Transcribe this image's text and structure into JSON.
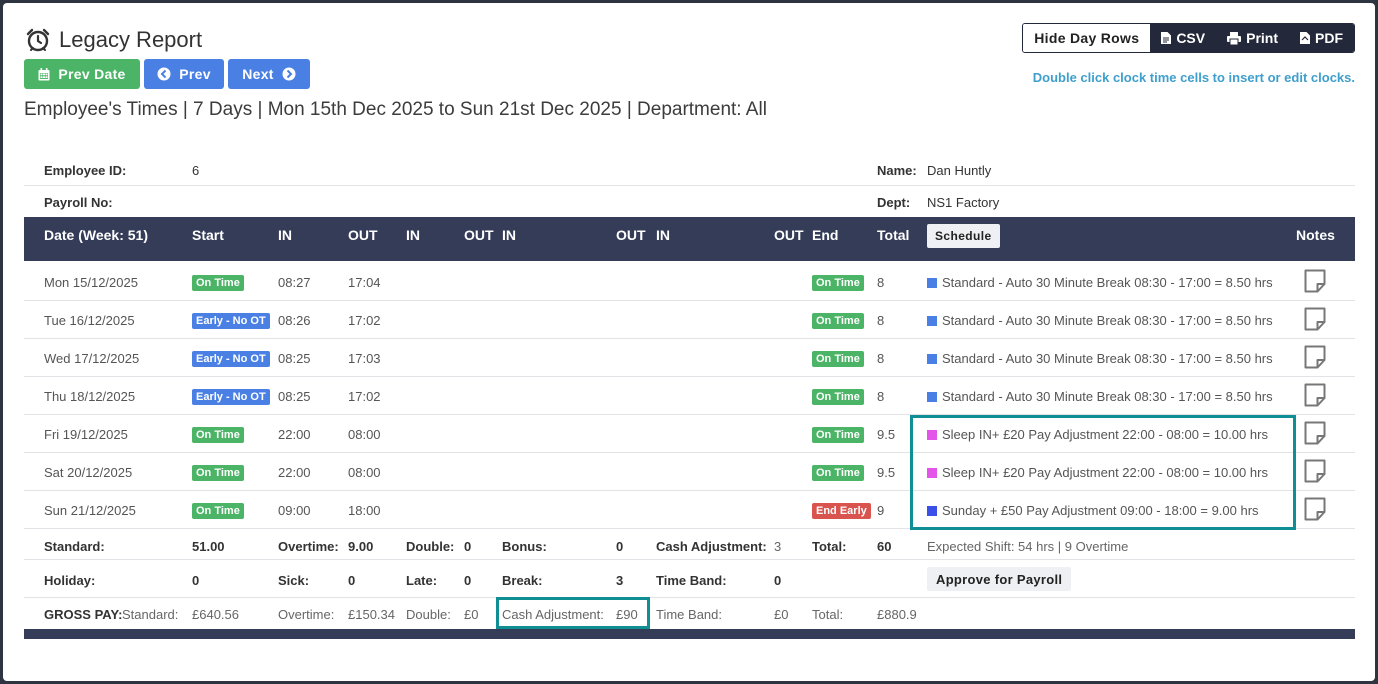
{
  "page": {
    "title": "Legacy Report",
    "headline": "Employee's Times | 7 Days | Mon 15th Dec 2025 to Sun 21st Dec 2025 | Department: All",
    "hint": "Double click clock time cells to insert or edit clocks."
  },
  "nav": {
    "prev_date": "Prev Date",
    "prev": "Prev",
    "next": "Next"
  },
  "toolbar": {
    "hide_day_rows": "Hide Day Rows",
    "csv": "CSV",
    "print": "Print",
    "pdf": "PDF"
  },
  "employee": {
    "id_label": "Employee ID:",
    "id": "6",
    "payroll_label": "Payroll No:",
    "payroll": "",
    "name_label": "Name:",
    "name": "Dan Huntly",
    "dept_label": "Dept:",
    "dept": "NS1 Factory"
  },
  "table_header": {
    "date": "Date (Week: 51)",
    "start": "Start",
    "in1": "IN",
    "out1": "OUT",
    "in2": "IN",
    "out2": "OUT",
    "in3": "IN",
    "out3": "OUT",
    "in4": "IN",
    "out4": "OUT",
    "end": "End",
    "total": "Total",
    "schedule": "Schedule",
    "notes": "Notes"
  },
  "colors": {
    "standard": "#4a80e4",
    "sleep": "#e255e8",
    "sunday": "#3b50e8",
    "highlight": "#0f8e93"
  },
  "rows": [
    {
      "date": "Mon 15/12/2025",
      "start": "On Time",
      "start_kind": "green",
      "in": "08:27",
      "out": "17:04",
      "end": "On Time",
      "end_kind": "green",
      "total": "8",
      "schedule": "Standard - Auto 30 Minute Break 08:30 - 17:00 = 8.50 hrs",
      "sched_color": "#4a80e4",
      "note_icon": "sticky-note-icon"
    },
    {
      "date": "Tue 16/12/2025",
      "start": "Early - No OT",
      "start_kind": "blue",
      "in": "08:26",
      "out": "17:02",
      "end": "On Time",
      "end_kind": "green",
      "total": "8",
      "schedule": "Standard - Auto 30 Minute Break 08:30 - 17:00 = 8.50 hrs",
      "sched_color": "#4a80e4",
      "note_icon": "sticky-note-icon"
    },
    {
      "date": "Wed 17/12/2025",
      "start": "Early - No OT",
      "start_kind": "blue",
      "in": "08:25",
      "out": "17:03",
      "end": "On Time",
      "end_kind": "green",
      "total": "8",
      "schedule": "Standard - Auto 30 Minute Break 08:30 - 17:00 = 8.50 hrs",
      "sched_color": "#4a80e4",
      "note_icon": "sticky-note-icon"
    },
    {
      "date": "Thu 18/12/2025",
      "start": "Early - No OT",
      "start_kind": "blue",
      "in": "08:25",
      "out": "17:02",
      "end": "On Time",
      "end_kind": "green",
      "total": "8",
      "schedule": "Standard - Auto 30 Minute Break 08:30 - 17:00 = 8.50 hrs",
      "sched_color": "#4a80e4",
      "note_icon": "sticky-note-icon"
    },
    {
      "date": "Fri 19/12/2025",
      "start": "On Time",
      "start_kind": "green",
      "in": "22:00",
      "out": "08:00",
      "end": "On Time",
      "end_kind": "green",
      "total": "9.5",
      "schedule": "Sleep IN+ £20 Pay Adjustment 22:00 - 08:00 = 10.00 hrs",
      "sched_color": "#e255e8",
      "note_icon": "sticky-note-icon"
    },
    {
      "date": "Sat 20/12/2025",
      "start": "On Time",
      "start_kind": "green",
      "in": "22:00",
      "out": "08:00",
      "end": "On Time",
      "end_kind": "green",
      "total": "9.5",
      "schedule": "Sleep IN+ £20 Pay Adjustment 22:00 - 08:00 = 10.00 hrs",
      "sched_color": "#e255e8",
      "note_icon": "sticky-note-icon"
    },
    {
      "date": "Sun 21/12/2025",
      "start": "On Time",
      "start_kind": "green",
      "in": "09:00",
      "out": "18:00",
      "end": "End Early",
      "end_kind": "red",
      "total": "9",
      "schedule": "Sunday + £50 Pay Adjustment 09:00 - 18:00 = 9.00 hrs",
      "sched_color": "#3b50e8",
      "note_icon": "sticky-note-icon"
    }
  ],
  "summary1": {
    "standard_label": "Standard:",
    "standard": "51.00",
    "overtime_label": "Overtime:",
    "overtime": "9.00",
    "double_label": "Double:",
    "double": "0",
    "bonus_label": "Bonus:",
    "bonus": "0",
    "cash_label": "Cash Adjustment:",
    "cash": "3",
    "total_label": "Total:",
    "total": "60",
    "expected": "Expected Shift: 54 hrs | 9 Overtime"
  },
  "summary2": {
    "holiday_label": "Holiday:",
    "holiday": "0",
    "sick_label": "Sick:",
    "sick": "0",
    "late_label": "Late:",
    "late": "0",
    "break_label": "Break:",
    "break": "3",
    "timeband_label": "Time Band:",
    "timeband": "0",
    "approve": "Approve for Payroll"
  },
  "gross": {
    "label": "GROSS PAY:",
    "standard_label": "Standard:",
    "standard": "£640.56",
    "overtime_label": "Overtime:",
    "overtime": "£150.34",
    "double_label": "Double:",
    "double": "£0",
    "cash_label": "Cash Adjustment:",
    "cash": "£90",
    "timeband_label": "Time Band:",
    "timeband": "£0",
    "total_label": "Total:",
    "total": "£880.9"
  }
}
